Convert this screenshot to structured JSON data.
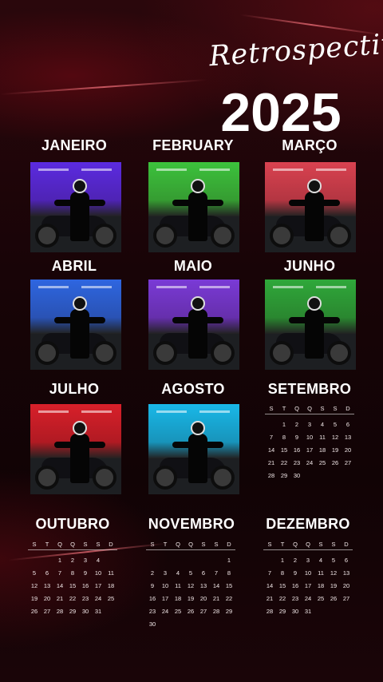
{
  "title": {
    "script": "Retrospectiva",
    "year": "2025"
  },
  "months": [
    {
      "label": "JANEIRO",
      "color": "#5b2be0"
    },
    {
      "label": "FEBRUARY",
      "color": "#3cc23c"
    },
    {
      "label": "MARÇO",
      "color": "#d94250"
    },
    {
      "label": "ABRIL",
      "color": "#2e66e0"
    },
    {
      "label": "MAIO",
      "color": "#7a3ad6"
    },
    {
      "label": "JUNHO",
      "color": "#2fa83a"
    },
    {
      "label": "JULHO",
      "color": "#d8202a"
    },
    {
      "label": "AGOSTO",
      "color": "#19b8e8"
    },
    {
      "label": "SETEMBRO"
    },
    {
      "label": "OUTUBRO"
    },
    {
      "label": "NOVEMBRO"
    },
    {
      "label": "DEZEMBRO"
    }
  ],
  "weekdays": [
    "S",
    "T",
    "Q",
    "Q",
    "S",
    "S",
    "D"
  ],
  "calendars": {
    "setembro": [
      [
        "",
        "1",
        "2",
        "3",
        "4",
        "5",
        "6"
      ],
      [
        "7",
        "8",
        "9",
        "10",
        "11",
        "12",
        "13"
      ],
      [
        "14",
        "15",
        "16",
        "17",
        "18",
        "19",
        "20"
      ],
      [
        "21",
        "22",
        "23",
        "24",
        "25",
        "26",
        "27"
      ],
      [
        "28",
        "29",
        "30",
        "",
        "",
        "",
        ""
      ]
    ],
    "outubro": [
      [
        "",
        "",
        "1",
        "2",
        "3",
        "4",
        ""
      ],
      [
        "5",
        "6",
        "7",
        "8",
        "9",
        "10",
        "11"
      ],
      [
        "12",
        "13",
        "14",
        "15",
        "16",
        "17",
        "18"
      ],
      [
        "19",
        "20",
        "21",
        "22",
        "23",
        "24",
        "25"
      ],
      [
        "26",
        "27",
        "28",
        "29",
        "30",
        "31",
        ""
      ]
    ],
    "novembro": [
      [
        "",
        "",
        "",
        "",
        "",
        "",
        "1"
      ],
      [
        "2",
        "3",
        "4",
        "5",
        "6",
        "7",
        "8"
      ],
      [
        "9",
        "10",
        "11",
        "12",
        "13",
        "14",
        "15"
      ],
      [
        "16",
        "17",
        "18",
        "19",
        "20",
        "21",
        "22"
      ],
      [
        "23",
        "24",
        "25",
        "26",
        "27",
        "28",
        "29"
      ],
      [
        "30",
        "",
        "",
        "",
        "",
        "",
        ""
      ]
    ],
    "dezembro": [
      [
        "",
        "1",
        "2",
        "3",
        "4",
        "5",
        "6"
      ],
      [
        "7",
        "8",
        "9",
        "10",
        "11",
        "12",
        "13"
      ],
      [
        "14",
        "15",
        "16",
        "17",
        "18",
        "19",
        "20"
      ],
      [
        "21",
        "22",
        "23",
        "24",
        "25",
        "26",
        "27"
      ],
      [
        "28",
        "29",
        "30",
        "31",
        "",
        "",
        ""
      ]
    ]
  }
}
